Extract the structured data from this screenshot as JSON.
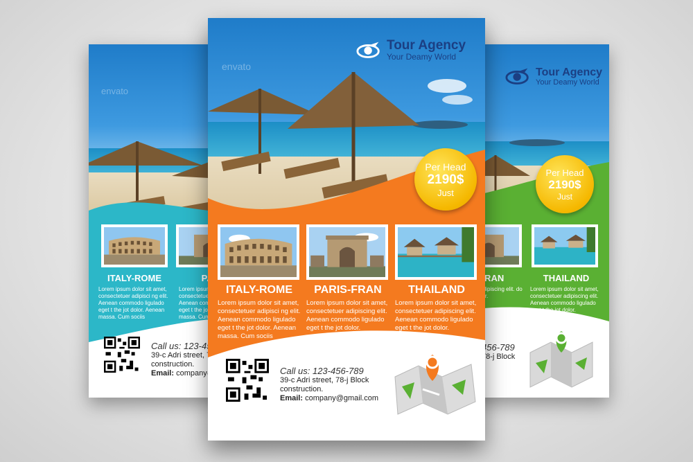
{
  "agency": {
    "name": "Tour Agency",
    "tagline": "Your Deamy World"
  },
  "watermark": "envato",
  "badge": {
    "line1": "Per Head",
    "price": "2190$",
    "line3": "Just"
  },
  "destinations": [
    {
      "title": "ITALY-ROME",
      "desc": "Lorem ipsum dolor sit amet, consectetuer adipisci ng elit. Aenean commodo ligulado eget t the jot dolor. Aenean massa. Cum sociis"
    },
    {
      "title": "PARIS-FRAN",
      "desc": "Lorem ipsum dolor sit amet, consectetuer adipiscing elit. Aenean commodo ligulado eget t the jot dolor."
    },
    {
      "title": "THAILAND",
      "desc": "Lorem ipsum dolor sit amet, consectetuer adipiscing elit. Aenean commodo ligulado eget t the jot dolor."
    }
  ],
  "left": {
    "dest2_title": "PARIS",
    "dest2_desc": "Lorem ipsum dolor sit amet, consectetuer adipisci ng elit. Aenean commodo ligulado eget t the jot dolor. Aenean massa. Cum sociis",
    "call": "Call us: 123-456",
    "addr1": "39-c Adri street, 78",
    "addr2": "construction.",
    "email_label": "Email:",
    "email": "company@gm"
  },
  "right": {
    "dest1_title": "-FRAN",
    "dest1_desc": "r sit amet, adipiscing elit. do ligulado dolor.",
    "call": "456-789",
    "addr": "78-j Block"
  },
  "contact": {
    "call": "Call us: 123-456-789",
    "addr1": "39-c Adri street, 78-j Block",
    "addr2": "construction.",
    "email_label": "Email:",
    "email": "company@gmail.com"
  },
  "colors": {
    "left_accent": "#2cb7c8",
    "center_accent": "#f47a1f",
    "right_accent": "#5ab033",
    "logo_blue": "#1b3f83",
    "badge_yellow": "#f5b800",
    "pin_orange": "#f47a1f",
    "pin_green": "#5ab033"
  },
  "icons": [
    "globe-swoosh-logo-icon",
    "qr-code-icon",
    "map-pin-icon",
    "folded-map-icon"
  ]
}
